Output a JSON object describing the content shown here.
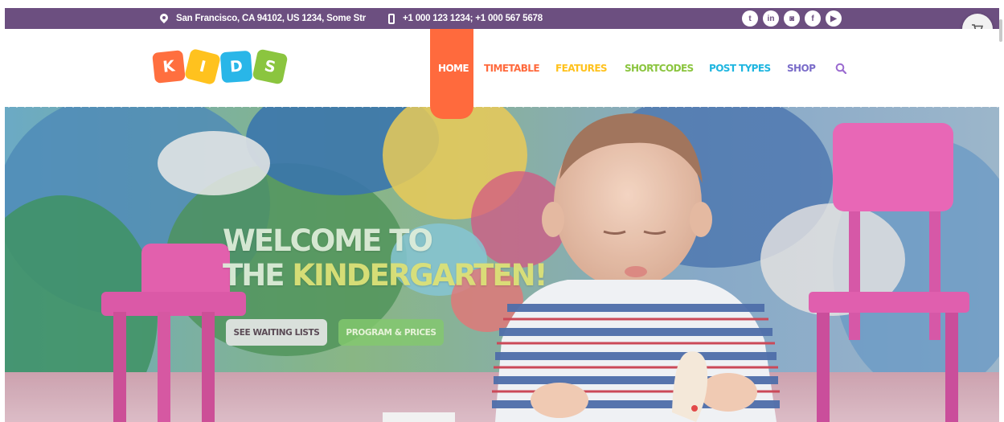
{
  "topbar": {
    "address": "San Francisco, CA 94102, US 1234, Some Str",
    "phone": "+1 000 123 1234; +1 000 567 5678",
    "socials": [
      {
        "name": "twitter",
        "glyph": "t"
      },
      {
        "name": "linkedin",
        "glyph": "in"
      },
      {
        "name": "instagram",
        "glyph": "◙"
      },
      {
        "name": "facebook",
        "glyph": "f"
      },
      {
        "name": "youtube",
        "glyph": "▶"
      }
    ]
  },
  "logo": {
    "letters": [
      "K",
      "I",
      "D",
      "S"
    ]
  },
  "nav": {
    "items": [
      {
        "label": "HOME",
        "color": "#ffffff"
      },
      {
        "label": "TIMETABLE",
        "color": "#ff6a3d"
      },
      {
        "label": "FEATURES",
        "color": "#ffc21e"
      },
      {
        "label": "SHORTCODES",
        "color": "#8bc53f"
      },
      {
        "label": "POST TYPES",
        "color": "#1fb6e0"
      },
      {
        "label": "SHOP",
        "color": "#7a6cc9"
      }
    ]
  },
  "hero": {
    "title_line1": "WELCOME TO",
    "title_line2a": "THE",
    "title_line2b": "KINDERGARTEN!",
    "button_waiting": "SEE WAITING LISTS",
    "button_prices": "PROGRAM & PRICES"
  },
  "colors": {
    "topbar": "#6c4f80",
    "accent_home": "#ff6a3d"
  }
}
